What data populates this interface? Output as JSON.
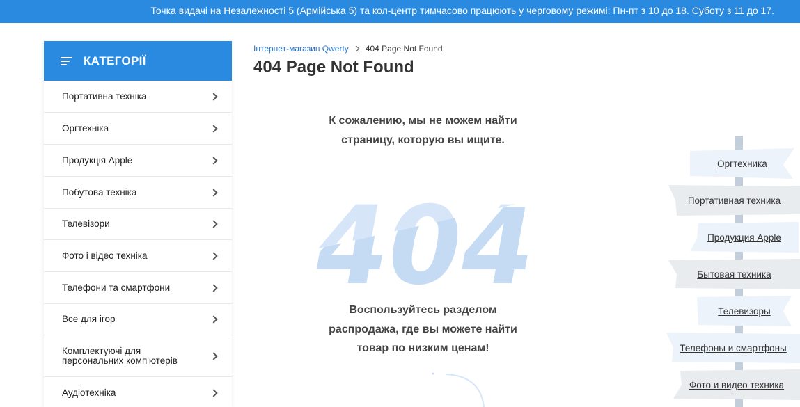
{
  "notice_bar": {
    "text": "Точка видачі на Незалежності 5 (Армійська 5) та кол-центр тимчасово працюють у черговому режимі: Пн-пт з 10 до 18. Суботу з 11 до 17."
  },
  "sidebar": {
    "title": "КАТЕГОРІЇ",
    "items": [
      {
        "label": "Портативна техніка"
      },
      {
        "label": "Оргтехніка"
      },
      {
        "label": "Продукція Apple"
      },
      {
        "label": "Побутова техніка"
      },
      {
        "label": "Телевізори"
      },
      {
        "label": "Фото і відео техніка"
      },
      {
        "label": "Телефони та смартфони"
      },
      {
        "label": "Все для ігор"
      },
      {
        "label": "Комплектуючі для персональних комп'ютерів"
      },
      {
        "label": "Аудіотехніка"
      }
    ]
  },
  "breadcrumb": {
    "home": "Інтернет-магазин Qwerty",
    "current": "404 Page Not Found"
  },
  "page": {
    "title": "404 Page Not Found",
    "message_top_line1": "К сожалению, мы не можем найти",
    "message_top_line2": "страницу, которую вы ищите.",
    "big_code": "404",
    "message_bottom_line1": "Воспользуйтесь разделом",
    "message_bottom_line2": "распродажа, где вы можете найти",
    "message_bottom_line3": "товар по низким ценам!"
  },
  "signpost": {
    "signs": [
      {
        "label": "Оргтехника"
      },
      {
        "label": "Портативная техника"
      },
      {
        "label": "Продукция Apple"
      },
      {
        "label": "Бытовая техника"
      },
      {
        "label": "Телевизоры"
      },
      {
        "label": "Телефоны и смартфоны"
      },
      {
        "label": "Фото и видео техника"
      }
    ]
  },
  "colors": {
    "accent": "#2a8ae0",
    "link": "#2a74c9",
    "big404_fill": "#d6e6f8",
    "sign_light": "#edf3fb",
    "sign_gray": "#e9ecef",
    "pole": "#c3cedb"
  },
  "icons": {
    "menu": "hamburger-icon",
    "item_arrow": "chevron-right-icon",
    "breadcrumb_separator": "chevron-right-icon"
  }
}
